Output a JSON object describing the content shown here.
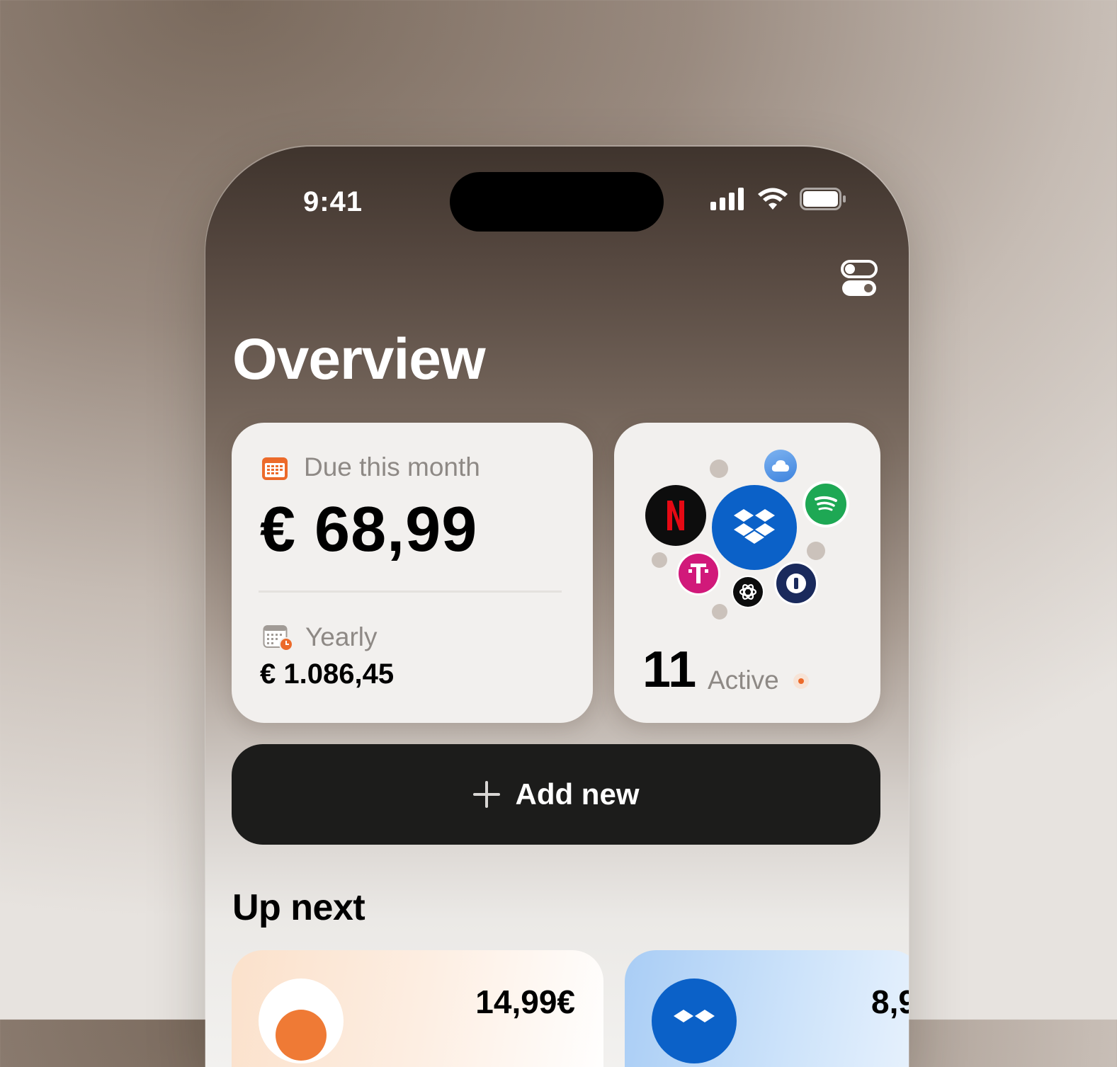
{
  "status_bar": {
    "time": "9:41"
  },
  "header": {
    "title": "Overview"
  },
  "due_card": {
    "label": "Due this month",
    "amount": "€ 68,99",
    "yearly_label": "Yearly",
    "yearly_amount": "€ 1.086,45"
  },
  "active_card": {
    "count": "11",
    "label": "Active",
    "services": [
      "Netflix",
      "Dropbox",
      "Spotify",
      "iCloud",
      "T-Mobile",
      "ChatGPT",
      "1Password"
    ]
  },
  "add_button": {
    "label": "Add new"
  },
  "up_next": {
    "title": "Up next",
    "items": [
      {
        "price": "14,99€"
      },
      {
        "price": "8,9"
      }
    ]
  },
  "colors": {
    "accent": "#ec6a2a",
    "button_bg": "#1c1c1b",
    "dropbox": "#0b61c8",
    "spotify": "#1ea854",
    "telekom": "#d1197a"
  }
}
